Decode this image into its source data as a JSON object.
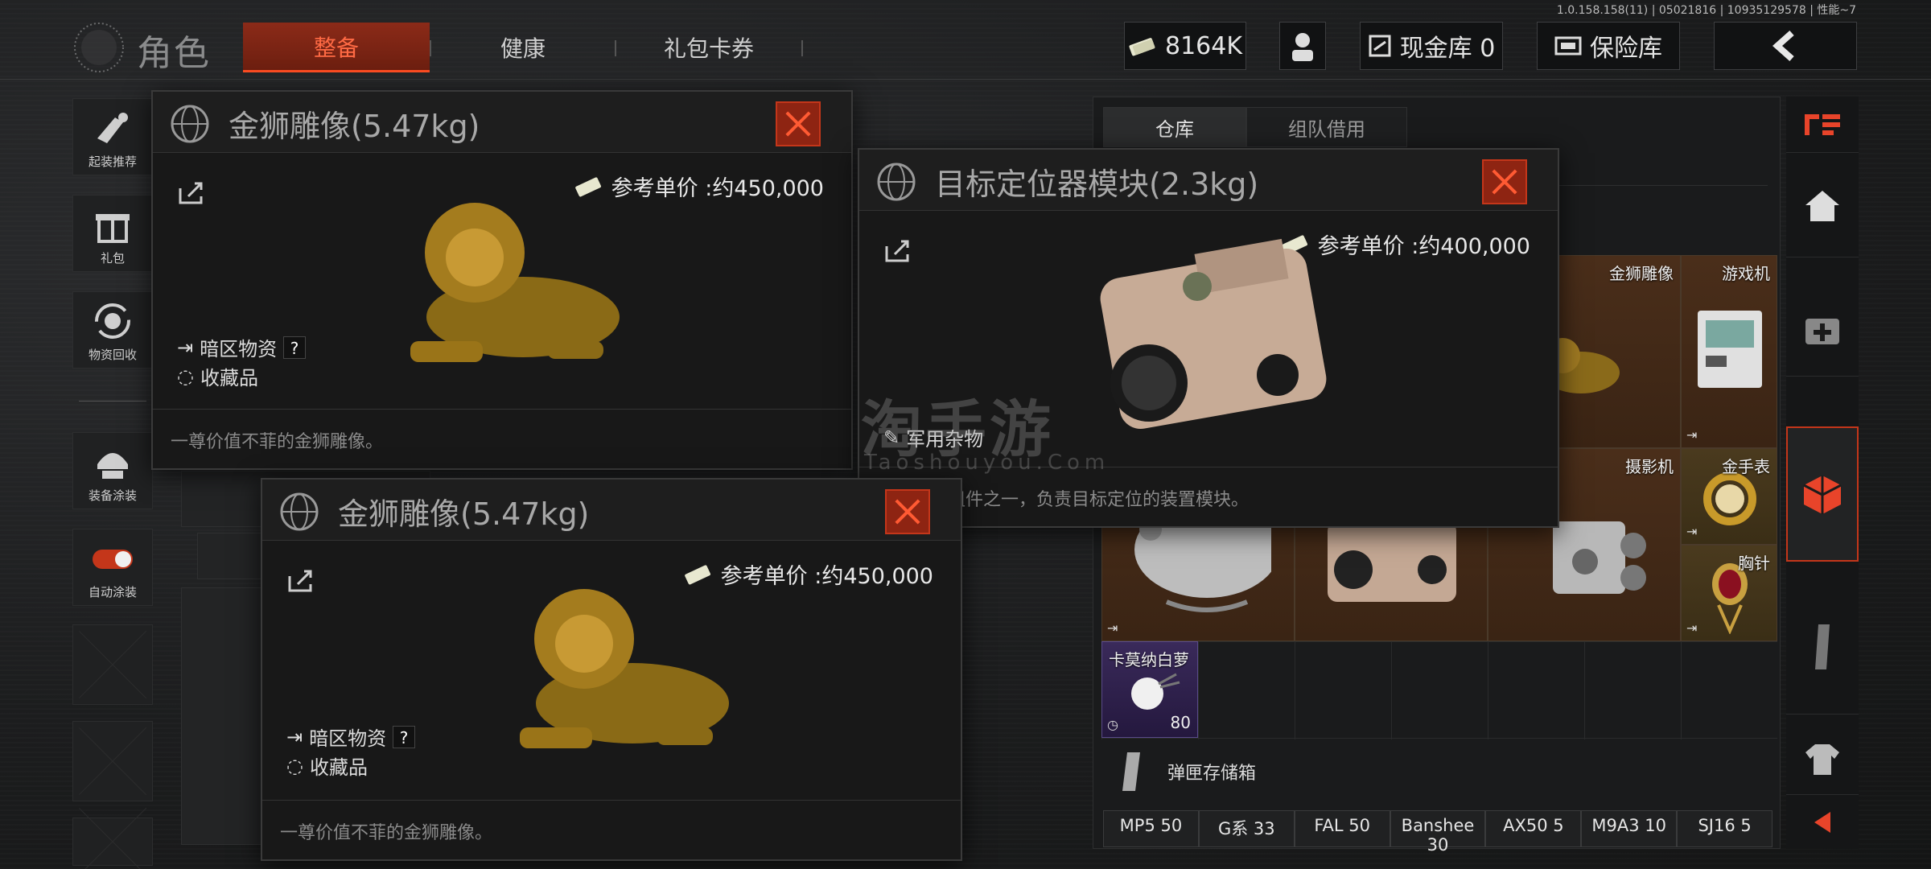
{
  "version": "1.0.158.158(11) | 05021816 | 10935129578 | 性能~7",
  "header": {
    "title": "角色",
    "tabs": [
      {
        "label": "整备",
        "active": true
      },
      {
        "label": "健康",
        "active": false
      },
      {
        "label": "礼包卡券",
        "active": false
      }
    ],
    "currency": "8164K",
    "cash_vault": "现金库 0",
    "insurance": "保险库"
  },
  "sidebar": {
    "items": [
      {
        "label": "起装推荐",
        "icon": "gear-recommend-icon"
      },
      {
        "label": "礼包",
        "icon": "gift-icon"
      },
      {
        "label": "物资回收",
        "icon": "recycle-icon"
      },
      {
        "label": "装备涂装",
        "icon": "helmet-paint-icon"
      },
      {
        "label": "自动涂装",
        "icon": "toggle-icon"
      }
    ]
  },
  "storage": {
    "tabs": [
      "仓库",
      "组队借用"
    ],
    "items": [
      {
        "name": "金狮雕像"
      },
      {
        "name": "游戏机"
      },
      {
        "name": "摄影机"
      },
      {
        "name": "金手表"
      },
      {
        "name": "胸针"
      },
      {
        "name": "卡莫纳白萝",
        "count": "80"
      }
    ],
    "ammo_box_label": "弹匣存储箱",
    "ammo": [
      "MP5 50",
      "G系 33",
      "FAL 50",
      "Banshee 30",
      "AX50 5",
      "M9A3 10",
      "SJ16 5"
    ]
  },
  "popups": [
    {
      "title": "金狮雕像(5.47kg)",
      "price": "参考单价 :约450,000",
      "tags": [
        "暗区物资",
        "收藏品"
      ],
      "desc": "一尊价值不菲的金狮雕像。"
    },
    {
      "title": "目标定位器模块(2.3kg)",
      "price": "参考单价 :约400,000",
      "tags": [
        "军用杂物"
      ],
      "desc": "测距仪的组件之一，负责目标定位的装置模块。"
    },
    {
      "title": "金狮雕像(5.47kg)",
      "price": "参考单价 :约450,000",
      "tags": [
        "暗区物资",
        "收藏品"
      ],
      "desc": "一尊价值不菲的金狮雕像。"
    }
  ],
  "watermark": {
    "cn": "淘手游",
    "en": "Taoshouyou.Com"
  },
  "colors": {
    "accent": "#c4361a",
    "accent_text": "#ff6a44"
  }
}
